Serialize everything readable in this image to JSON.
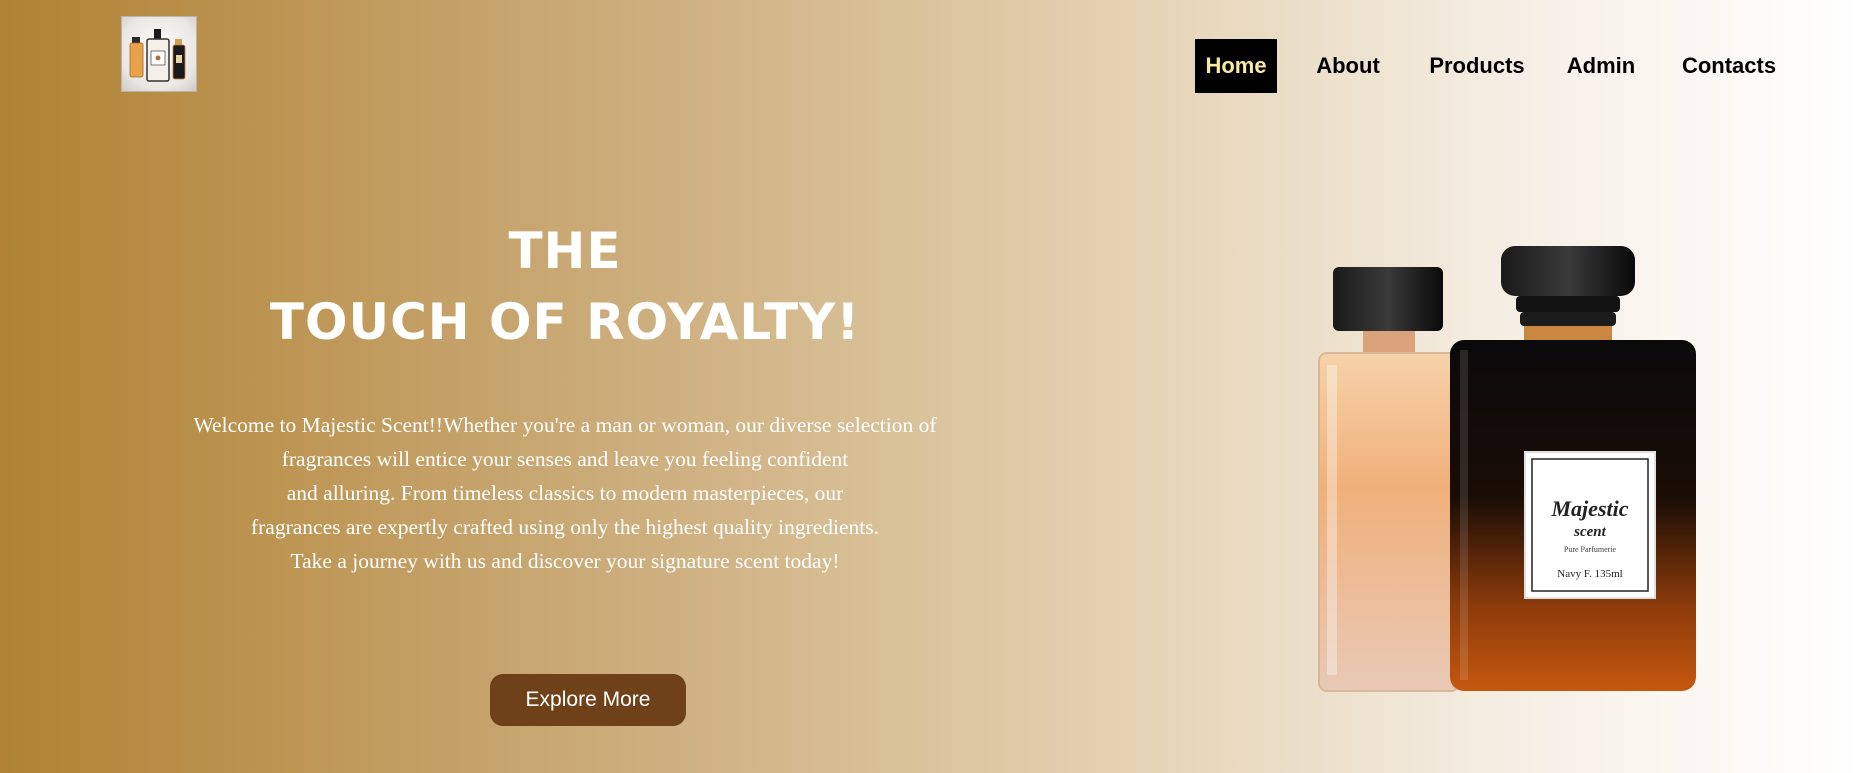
{
  "logo": {
    "icon": "perfume-bottles-logo-icon"
  },
  "nav": {
    "items": [
      {
        "label": "Home",
        "active": true
      },
      {
        "label": "About",
        "active": false
      },
      {
        "label": "Products",
        "active": false
      },
      {
        "label": "Admin",
        "active": false
      },
      {
        "label": "Contacts",
        "active": false
      }
    ]
  },
  "hero": {
    "title_line1": "THE",
    "title_line2": "TOUCH OF ROYALTY!",
    "text_lines": [
      "Welcome to Majestic Scent!!Whether you're a man or woman, our diverse selection of",
      "fragrances will entice your senses and leave you feeling confident",
      "and alluring. From timeless classics to modern masterpieces, our",
      "fragrances are expertly crafted using only the highest quality ingredients.",
      "Take a journey with us and discover your signature scent today!"
    ],
    "button_label": "Explore More"
  },
  "product_image": {
    "label_line1": "Majestic",
    "label_line2": "scent",
    "label_line3": "Pure Parfumerie",
    "label_line4": "Navy F. 135ml"
  },
  "colors": {
    "gradient_start": "#b08232",
    "gradient_end": "#ffffff",
    "nav_active_bg": "#000000",
    "nav_active_text": "#f6e8a6",
    "button_bg": "#6e4118"
  }
}
